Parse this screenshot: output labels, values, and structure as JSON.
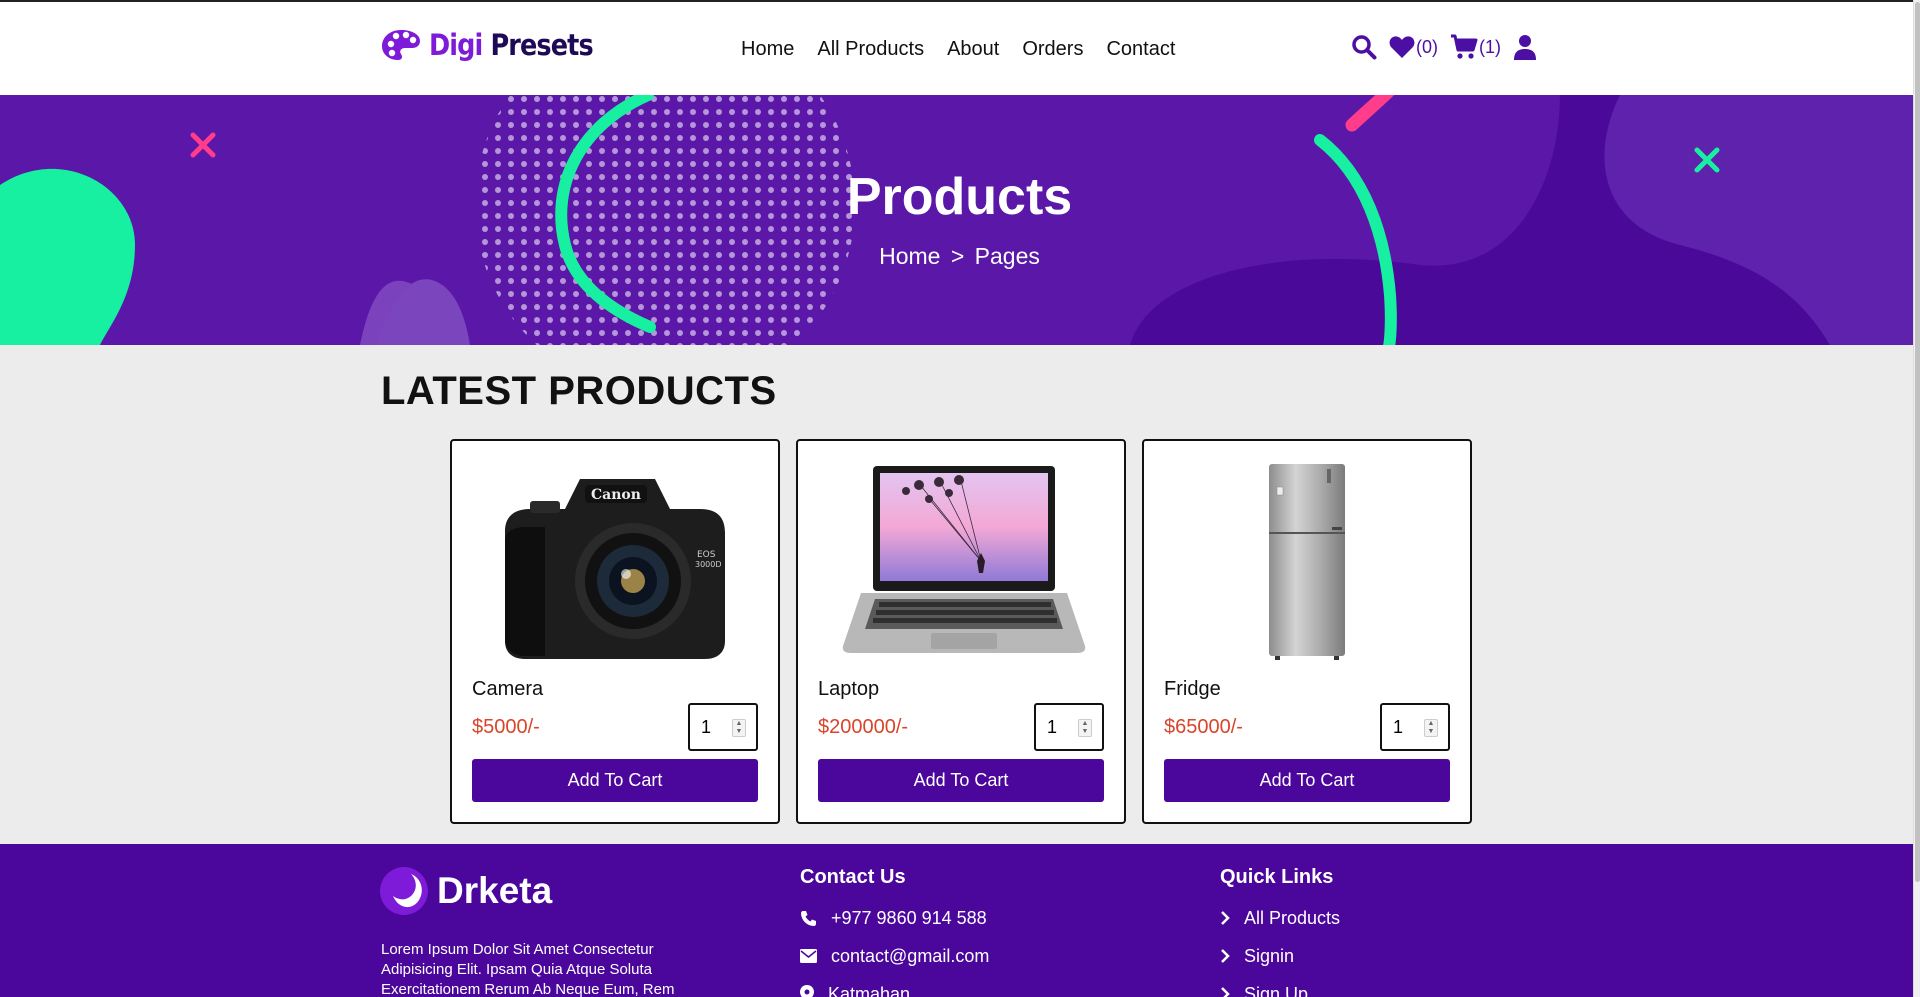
{
  "header": {
    "logo": {
      "part1": "Digi",
      "part2": "Presets"
    },
    "nav": [
      "Home",
      "All Products",
      "About",
      "Orders",
      "Contact"
    ],
    "wishlist_count": "(0)",
    "cart_count": "(1)"
  },
  "banner": {
    "title": "Products",
    "breadcrumb": {
      "home": "Home",
      "separator": ">",
      "current": "Pages"
    }
  },
  "products": {
    "section_title": "LATEST PRODUCTS",
    "items": [
      {
        "name": "Camera",
        "price": "$5000/-",
        "qty": "1",
        "button": "Add To Cart"
      },
      {
        "name": "Laptop",
        "price": "$200000/-",
        "qty": "1",
        "button": "Add To Cart"
      },
      {
        "name": "Fridge",
        "price": "$65000/-",
        "qty": "1",
        "button": "Add To Cart"
      }
    ]
  },
  "footer": {
    "brand": "Drketa",
    "about": "Lorem Ipsum Dolor Sit Amet Consectetur Adipisicing Elit. Ipsam Quia Atque Soluta Exercitationem Rerum Ab Neque Eum, Rem",
    "contact": {
      "title": "Contact Us",
      "phone": "+977 9860 914 588",
      "email": "contact@gmail.com",
      "address": "Katmahan"
    },
    "quick_links": {
      "title": "Quick Links",
      "items": [
        "All Products",
        "Signin",
        "Sign Up"
      ]
    }
  },
  "colors": {
    "primary": "#4b069c",
    "banner": "#5a17a8",
    "accent_green": "#16f0a0",
    "accent_pink": "#ff3d8a",
    "price": "#d9452b"
  }
}
